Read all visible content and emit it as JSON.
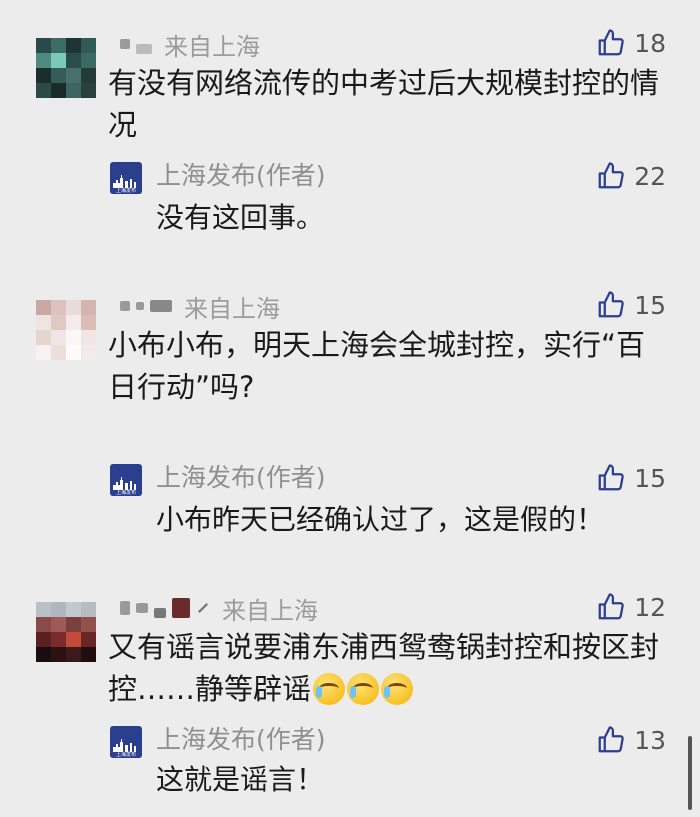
{
  "comments": [
    {
      "location": "来自上海",
      "likes": "18",
      "text": "有没有网络流传的中考过后大规模封控的情况",
      "reply": {
        "author": "上海发布(作者)",
        "likes": "22",
        "text": "没有这回事。",
        "logo_text": "上海发布"
      }
    },
    {
      "location": "来自上海",
      "likes": "15",
      "text": "小布小布，明天上海会全城封控，实行“百日行动”吗?",
      "reply": {
        "author": "上海发布(作者)",
        "likes": "15",
        "text": "小布昨天已经确认过了，这是假的！",
        "logo_text": "上海发布"
      }
    },
    {
      "location": "来自上海",
      "likes": "12",
      "text": "又有谣言说要浦东浦西鸳鸯锅封控和按区封控……静等辟谣",
      "reply": {
        "author": "上海发布(作者)",
        "likes": "13",
        "text": "这就是谣言！",
        "logo_text": "上海发布"
      }
    }
  ],
  "icons": {
    "like": "thumbs-up-icon",
    "emoji": "crying-laughing-emoji"
  },
  "colors": {
    "background": "#ececec",
    "text": "#1a1a1a",
    "meta": "#9b9b9b",
    "publisher_logo": "#2b3f8f"
  }
}
